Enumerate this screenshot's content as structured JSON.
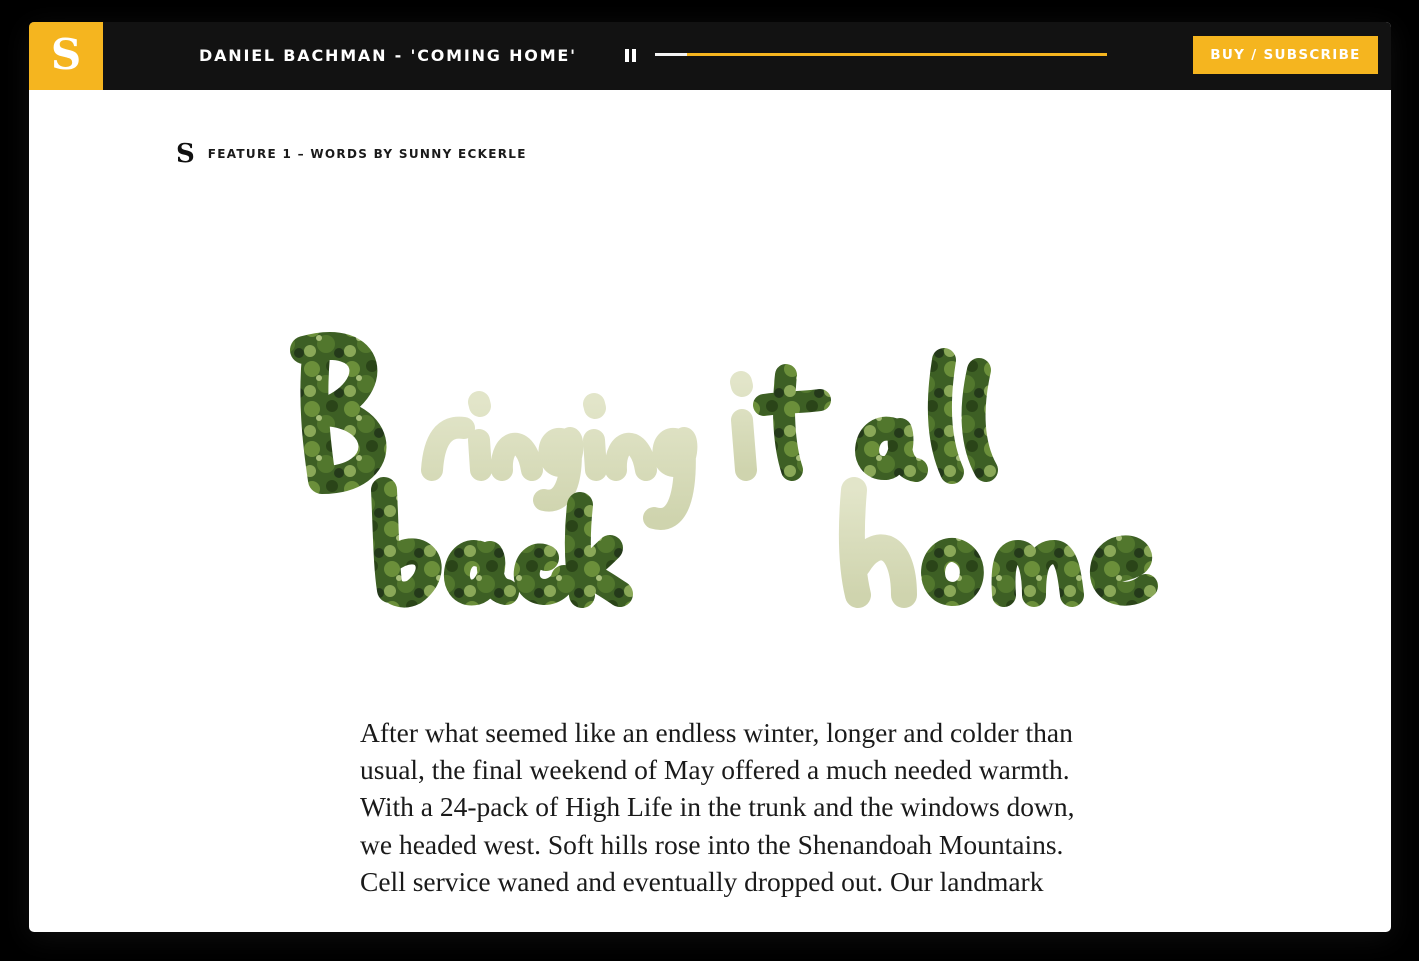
{
  "topbar": {
    "logo_letter": "S",
    "track_title": "DANIEL BACHMAN - 'COMING HOME'",
    "progress": 0.07,
    "buy_label": "BUY / SUBSCRIBE"
  },
  "byline": {
    "logo_letter": "S",
    "text": "FEATURE 1 – WORDS BY SUNNY ECKERLE"
  },
  "hero": {
    "title_image_text": "Bringing it all back home"
  },
  "article": {
    "paragraph": "After what seemed like an endless winter, longer and colder than usual, the final weekend of May offered a much needed warmth. With a 24-pack of High Life in the trunk and the windows down, we headed west. Soft hills rose into the Shenandoah Mountains. Cell service waned and eventually dropped out. Our landmark"
  },
  "colors": {
    "accent": "#f5b51f",
    "topbar_bg": "#121212",
    "page_bg": "#ffffff",
    "foliage_dark": "#2f4e1c",
    "foliage_mid": "#55782e",
    "foliage_pale": "#d8dcbd"
  },
  "icons": {
    "pause": "pause-icon"
  }
}
